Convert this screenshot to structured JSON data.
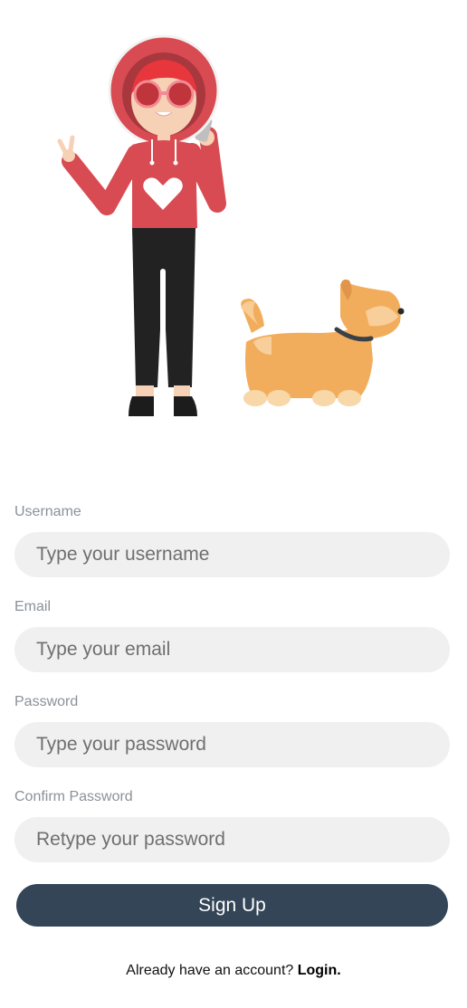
{
  "form": {
    "username_label": "Username",
    "username_placeholder": "Type your username",
    "email_label": "Email",
    "email_placeholder": "Type your email",
    "password_label": "Password",
    "password_placeholder": "Type your password",
    "confirm_label": "Confirm Password",
    "confirm_placeholder": "Retype your password",
    "signup_label": "Sign Up"
  },
  "footer": {
    "prompt": "Already have an account?",
    "login_label": "Login."
  },
  "colors": {
    "button": "#334556",
    "input_bg": "#f0f0f0",
    "label": "#8a9199",
    "hoodie": "#d94b52",
    "dog": "#f2ad5c"
  },
  "hero": {
    "illustration": "person-in-red-hoodie-walking-dog"
  }
}
